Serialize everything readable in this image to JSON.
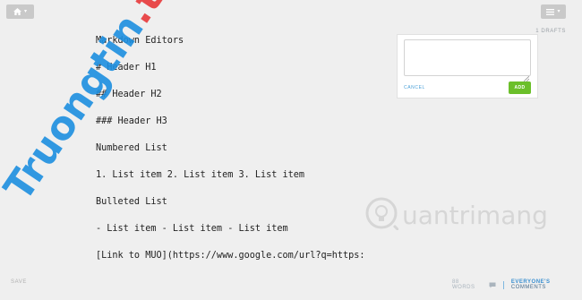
{
  "toolbar": {
    "home_icon": "home-icon",
    "menu_icon": "list-icon",
    "caret_icon": "caret-down-icon"
  },
  "editor": {
    "lines": [
      "Markdown Editors",
      "# Header H1",
      "## Header H2",
      "### Header H3",
      "Numbered List",
      "1. List item 2. List item 3. List item",
      "Bulleted List",
      "- List item - List item - List item",
      "[Link to MUO](https://www.google.com/url?q=https:"
    ]
  },
  "drafts": {
    "label": "1 DRAFTS",
    "textarea_value": "",
    "cancel_label": "CANCEL",
    "add_label": "ADD"
  },
  "footer": {
    "left_label": "SAVE",
    "word_count": "88 WORDS",
    "comment_icon": "comment-icon",
    "everyones_label": "EVERYONE'S",
    "comments_label": " COMMENTS"
  },
  "watermarks": {
    "truongtin_part1": "Truongtin",
    "truongtin_part2": ".top",
    "quantrimang": "uantrimang"
  },
  "colors": {
    "background": "#efefef",
    "add_button": "#6bbf2a",
    "link_blue": "#4aa0d8",
    "toolbar_button": "#c9c9c9"
  }
}
